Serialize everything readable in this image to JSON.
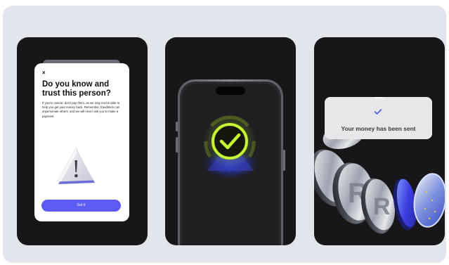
{
  "screens": {
    "warning": {
      "close_glyph": "×",
      "title": "Do you know and trust this person?",
      "body": "If you're unsure, don't pay them, as we may not be able to help you get your money back. Remember, fraudsters can impersonate others, and we will never ask you to make a payment.",
      "button_label": "Got it"
    },
    "success_phone": {
      "icon": "checkmark-circle-icon"
    },
    "payment_sent": {
      "message": "Your money has been sent",
      "icon": "checkmark-icon"
    }
  },
  "colors": {
    "background": "#e2e6ec",
    "panel": "#17171a",
    "accent": "#5b5cf6",
    "success": "#c6f432"
  }
}
